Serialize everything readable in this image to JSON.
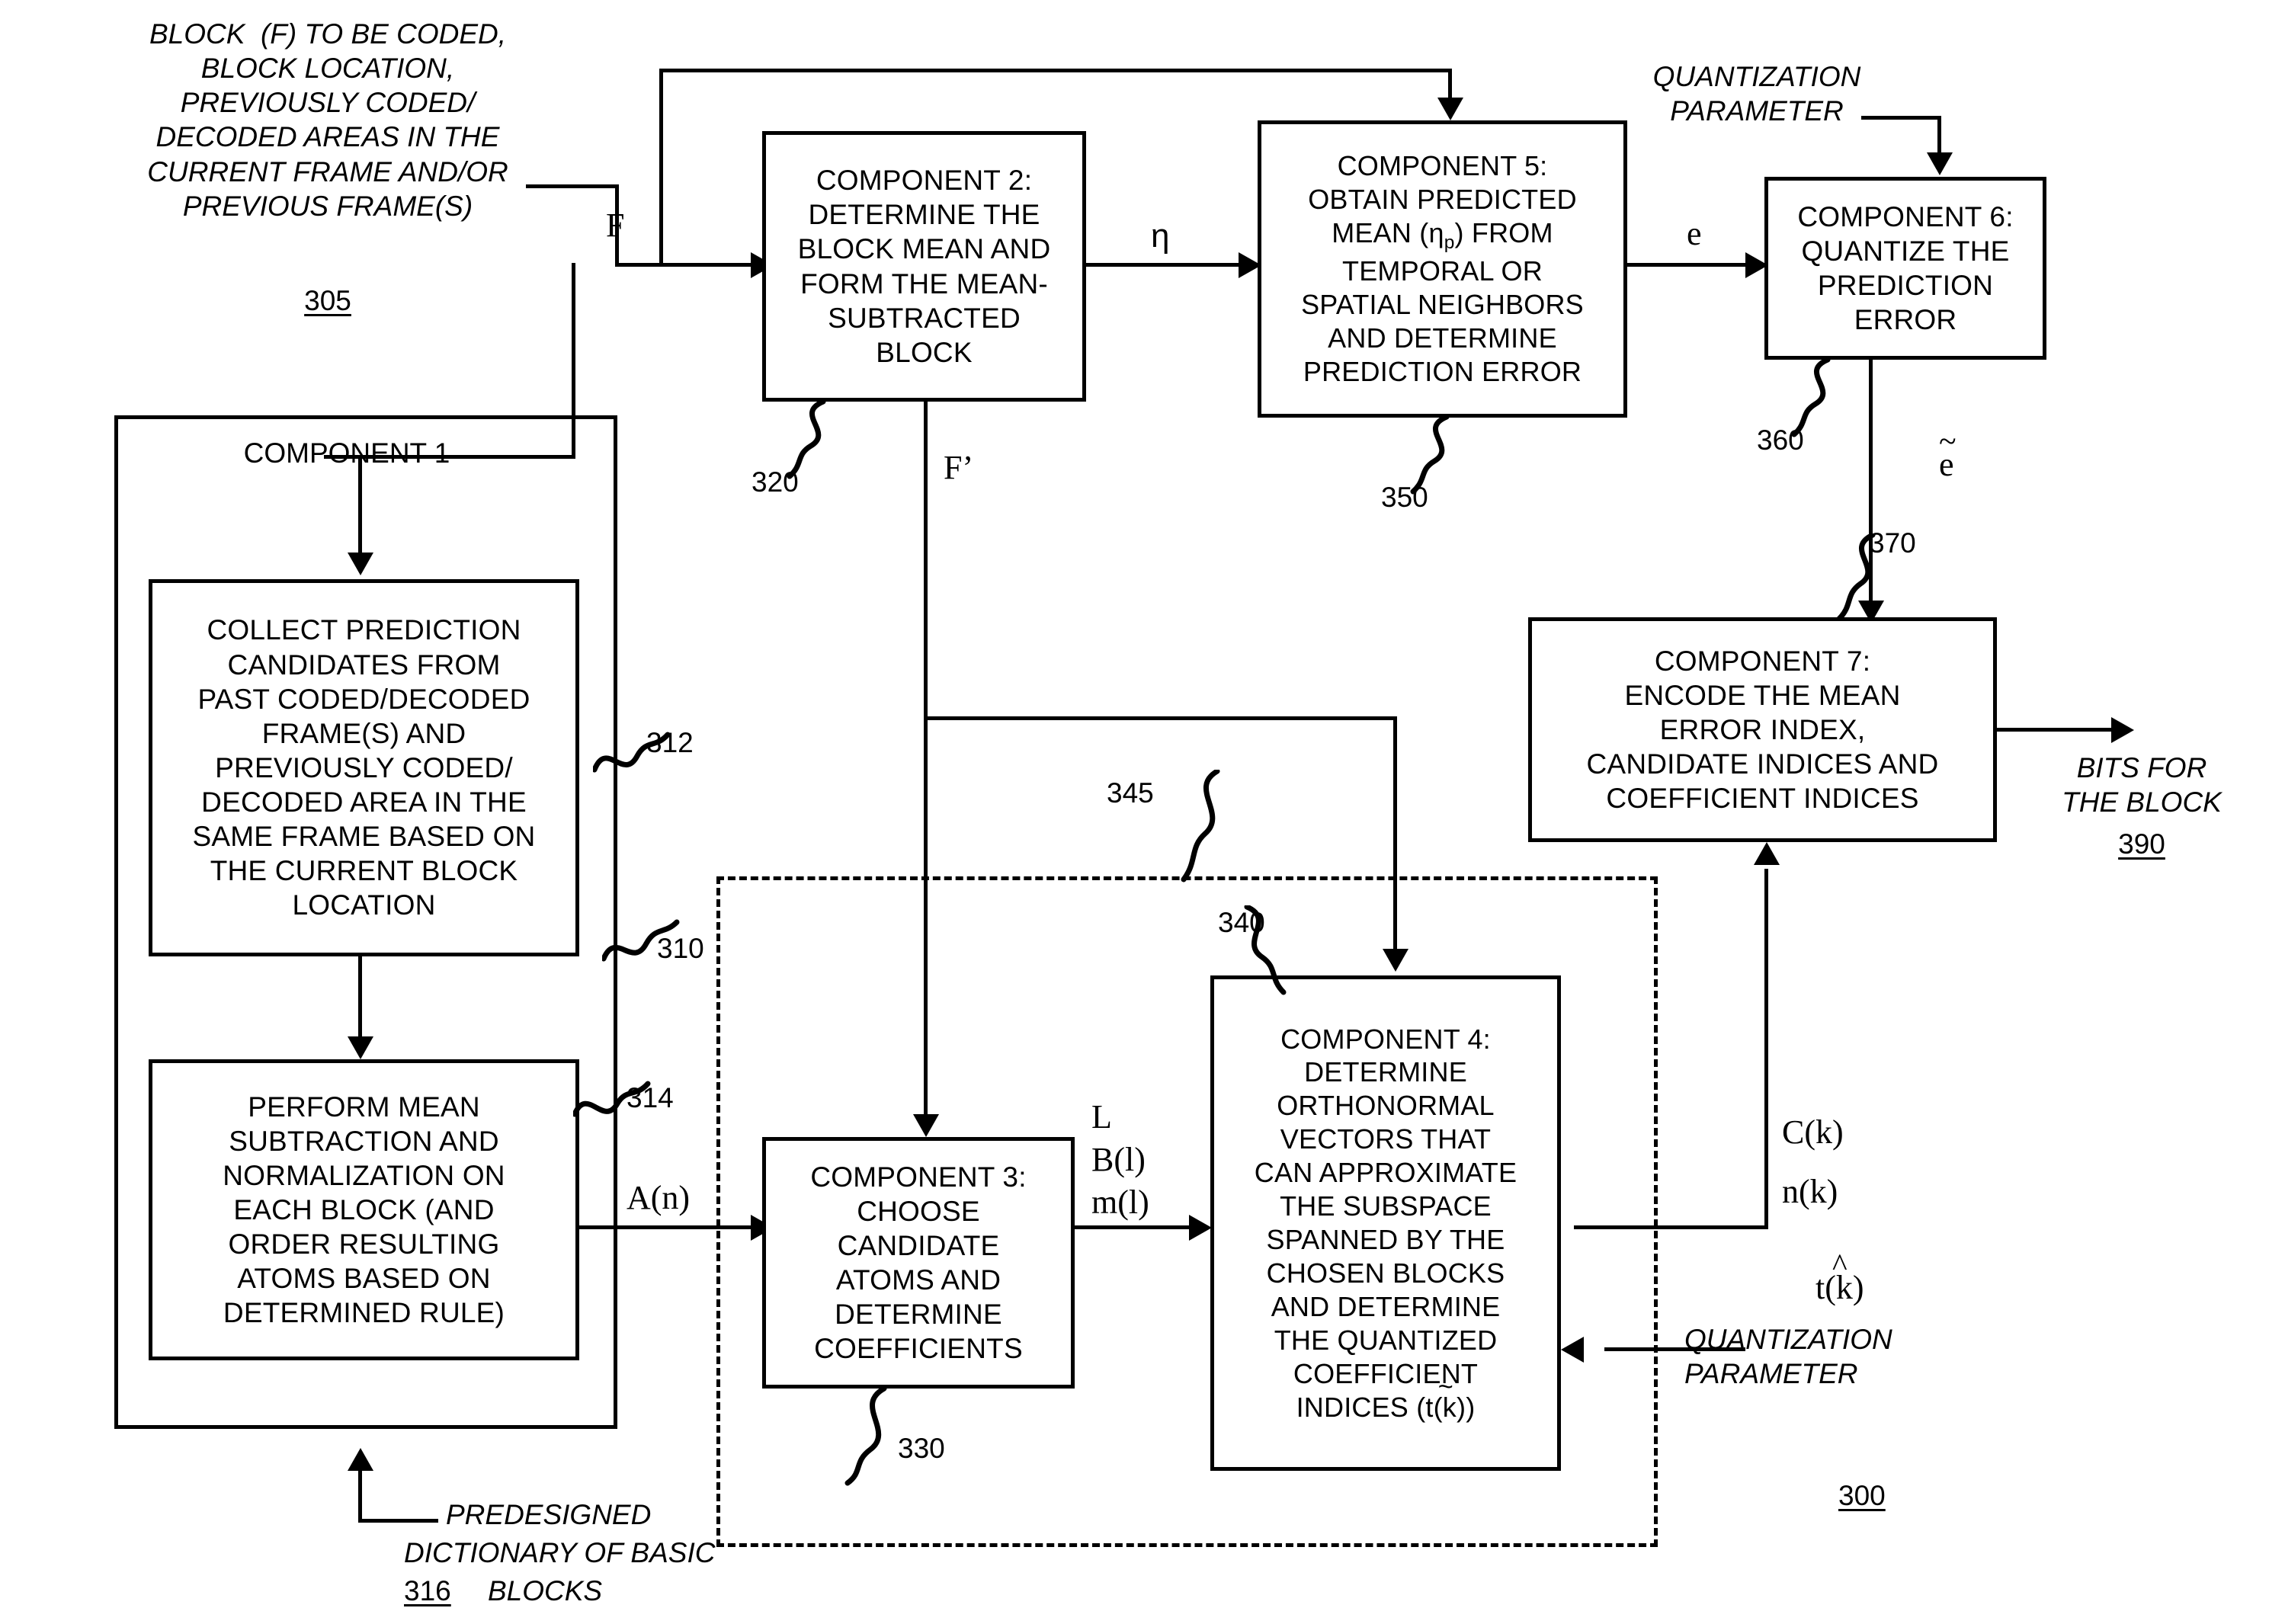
{
  "figure": {
    "reference_number": "300"
  },
  "inputs": {
    "block_input": {
      "text": "BLOCK  (F) TO BE CODED,\nBLOCK LOCATION,\nPREVIOUSLY CODED/\nDECODED AREAS IN THE\nCURRENT FRAME AND/OR\nPREVIOUS FRAME(S)",
      "ref": "305"
    },
    "dictionary": {
      "line1": "PREDESIGNED",
      "line2": "DICTIONARY OF BASIC",
      "line3": "BLOCKS",
      "ref": "316"
    },
    "quantization_parameter_top": "QUANTIZATION\nPARAMETER",
    "quantization_parameter_bottom": "QUANTIZATION\nPARAMETER"
  },
  "outputs": {
    "bits_for_block": {
      "text": "BITS FOR\nTHE BLOCK",
      "ref": "390"
    }
  },
  "containers": {
    "component1": {
      "title": "COMPONENT 1",
      "ref": "310"
    },
    "dashed_group": {
      "ref": "345"
    }
  },
  "boxes": [
    {
      "id": "collect-candidates",
      "text": "COLLECT PREDICTION\nCANDIDATES FROM\nPAST CODED/DECODED\nFRAME(S) AND\nPREVIOUSLY CODED/\nDECODED AREA IN THE\nSAME FRAME BASED ON\nTHE CURRENT BLOCK\nLOCATION",
      "ref": "312"
    },
    {
      "id": "perform-mean-subtraction",
      "text": "PERFORM MEAN\nSUBTRACTION AND\nNORMALIZATION ON\nEACH BLOCK (AND\nORDER RESULTING\nATOMS BASED ON\nDETERMINED RULE)",
      "ref": "314"
    },
    {
      "id": "component2",
      "text": "COMPONENT 2:\nDETERMINE THE\nBLOCK MEAN AND\nFORM THE MEAN-\nSUBTRACTED\nBLOCK",
      "ref": "320"
    },
    {
      "id": "component3",
      "text": "COMPONENT 3:\nCHOOSE\nCANDIDATE\nATOMS AND\nDETERMINE\nCOEFFICIENTS",
      "ref": "330"
    },
    {
      "id": "component4",
      "text_before_formula": "COMPONENT 4:\nDETERMINE\nORTHONORMAL\nVECTORS THAT\nCAN APPROXIMATE\nTHE SUBSPACE\nSPANNED BY THE\nCHOSEN BLOCKS\nAND DETERMINE\nTHE QUANTIZED\nCOEFFICIENT\nINDICES (",
      "formula_base": "t(k)",
      "formula_accent": "~",
      "text_after_formula": ")",
      "ref": "340"
    },
    {
      "id": "component5",
      "line1": "COMPONENT 5:",
      "line2": "OBTAIN PREDICTED",
      "line3_a": "MEAN (η",
      "line3_sub": "p",
      "line3_b": ") FROM",
      "line4": "TEMPORAL OR",
      "line5": "SPATIAL NEIGHBORS",
      "line6": "AND DETERMINE",
      "line7": "PREDICTION ERROR",
      "ref": "350"
    },
    {
      "id": "component6",
      "text": "COMPONENT 6:\nQUANTIZE THE\nPREDICTION\nERROR",
      "ref": "360"
    },
    {
      "id": "component7",
      "text": "COMPONENT 7:\nENCODE THE MEAN\nERROR INDEX,\nCANDIDATE INDICES AND\nCOEFFICIENT INDICES",
      "ref": "370"
    }
  ],
  "signals": {
    "F": "F",
    "F_prime": "F’",
    "eta": "η",
    "e": "e",
    "e_tilde_base": "e",
    "e_tilde_accent": "~",
    "A_n": "A(n)",
    "L": "L",
    "B_l": "B(l)",
    "m_l": "m(l)",
    "C_k": "C(k)",
    "n_k": "n(k)",
    "t_hat_base": "t(k)",
    "t_hat_accent": "^"
  },
  "colors": {
    "stroke": "#000000",
    "background": "#ffffff"
  }
}
